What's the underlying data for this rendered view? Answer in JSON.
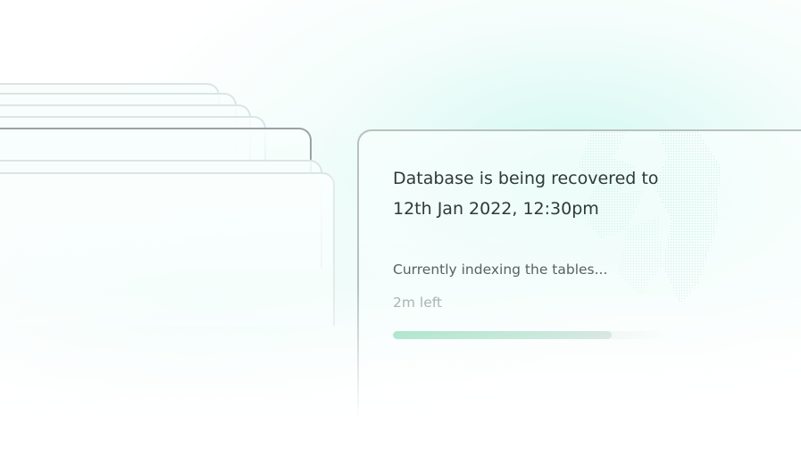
{
  "recovery": {
    "title_line1": "Database is being recovered to",
    "title_line2": "12th Jan 2022, 12:30pm",
    "status": "Currently indexing the tables...",
    "time_left": "2m left",
    "progress": 0.79
  },
  "colors": {
    "accent": "#86d9b4",
    "text_primary": "#2f3a38",
    "text_secondary": "#58625f",
    "text_muted": "#a1a9a7",
    "background_tint": "#d8f8f2"
  },
  "icons": [
    "dotted-illustration"
  ]
}
